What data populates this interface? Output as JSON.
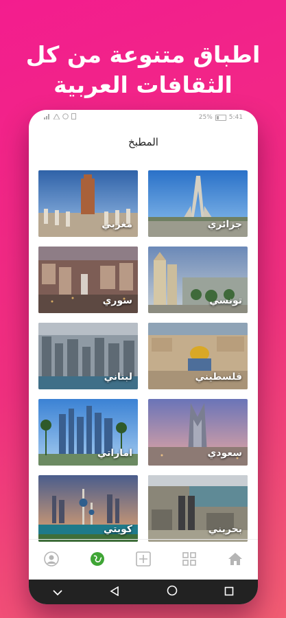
{
  "headline": {
    "line1": "اطباق متنوعة من كل",
    "line2": "الثقافات العربية"
  },
  "status_bar": {
    "battery_percent": "25%",
    "time": "5:41"
  },
  "screen_title": "المطبخ",
  "cuisines": [
    {
      "label": "مغربي",
      "scene": "hassan-tower"
    },
    {
      "label": "جزائري",
      "scene": "martyrs-memorial"
    },
    {
      "label": "سوري",
      "scene": "damascus-city"
    },
    {
      "label": "تونسي",
      "scene": "tunis-avenue"
    },
    {
      "label": "لبناني",
      "scene": "beirut-city"
    },
    {
      "label": "فلسطيني",
      "scene": "dome-of-the-rock"
    },
    {
      "label": "اماراتي",
      "scene": "dubai-skyline"
    },
    {
      "label": "سعودي",
      "scene": "kingdom-tower"
    },
    {
      "label": "كويتي",
      "scene": "kuwait-towers"
    },
    {
      "label": "بحريني",
      "scene": "bahrain-trade-center"
    }
  ],
  "bottom_nav": [
    {
      "name": "profile",
      "icon": "user-icon"
    },
    {
      "name": "explore",
      "icon": "globe-icon",
      "active": true
    },
    {
      "name": "add",
      "icon": "plus-icon"
    },
    {
      "name": "categories",
      "icon": "grid-icon"
    },
    {
      "name": "home",
      "icon": "home-icon"
    }
  ],
  "colors": {
    "accent_active": "#3fa535",
    "background_from": "#f31d8e",
    "background_to": "#f25d73"
  }
}
